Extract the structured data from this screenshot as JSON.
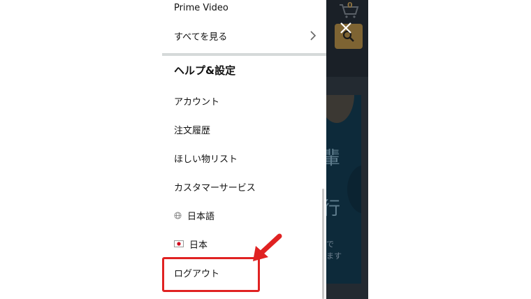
{
  "menu": {
    "prime_video": "Prime Video",
    "see_all": "すべてを見る",
    "section_title": "ヘルプ&設定",
    "account": "アカウント",
    "order_history": "注文履歴",
    "wishlist": "ほしい物リスト",
    "customer_service": "カスタマーサービス",
    "language": "日本語",
    "country": "日本",
    "logout": "ログアウト"
  },
  "backdrop": {
    "cart_count": "0",
    "banner_glyph_1": "輩",
    "banner_glyph_2": "行",
    "banner_text_1": "で",
    "banner_text_2": "ます"
  },
  "colors": {
    "highlight": "#e02222",
    "search_button": "#7e6433",
    "backdrop": "#232a31"
  },
  "icons": [
    "globe-icon",
    "japan-flag-icon",
    "chevron-right-icon",
    "close-icon",
    "cart-icon",
    "search-icon",
    "red-arrow-icon"
  ]
}
